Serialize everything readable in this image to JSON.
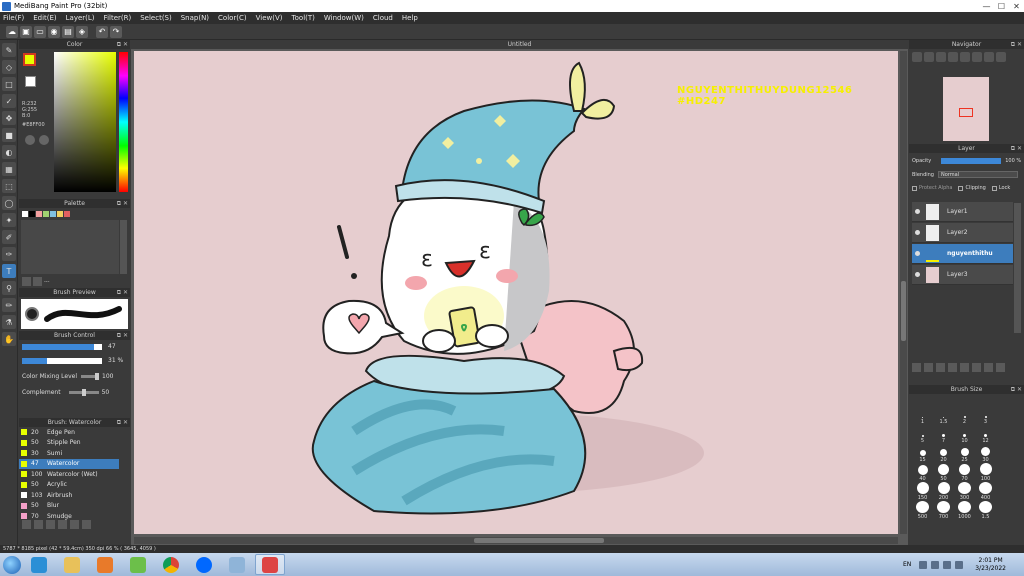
{
  "window": {
    "title": "MediBang Paint Pro (32bit)",
    "minimize": "—",
    "maximize": "☐",
    "close": "✕"
  },
  "menu": [
    "File(F)",
    "Edit(E)",
    "Layer(L)",
    "Filter(R)",
    "Select(S)",
    "Snap(N)",
    "Color(C)",
    "View(V)",
    "Tool(T)",
    "Window(W)",
    "Cloud",
    "Help"
  ],
  "canvas": {
    "tab_title": "Untitled",
    "watermark_line1": "NGUYENTHITHUYDUNG12546",
    "watermark_line2": "#HD247",
    "background": "#e6cdcf"
  },
  "color_panel": {
    "title": "Color",
    "r": "R:232",
    "g": "G:255",
    "b": "B:0",
    "hex": "#E8FF00",
    "foreground": "#e8ff00",
    "background": "#ffffff"
  },
  "palette_panel": {
    "title": "Palette",
    "colors": [
      "#ffffff",
      "#000000",
      "#f4a0a0",
      "#a0d070",
      "#80c0e0",
      "#f0d060",
      "#e06060"
    ],
    "tools_text": "---"
  },
  "brush_preview": {
    "title": "Brush Preview"
  },
  "brush_control": {
    "title": "Brush Control",
    "size_value": "47",
    "opacity_value": "31 %",
    "mixing_label": "Color Mixing Level",
    "mixing_value": "100",
    "complement_label": "Complement",
    "complement_value": "50",
    "size_fraction": 0.9,
    "opacity_fraction": 0.31
  },
  "brush_list": {
    "title": "Brush: Watercolor",
    "items": [
      {
        "size": "20",
        "name": "Edge Pen",
        "color": "#e8ff00"
      },
      {
        "size": "50",
        "name": "Stipple Pen",
        "color": "#e8ff00"
      },
      {
        "size": "30",
        "name": "Sumi",
        "color": "#e8ff00"
      },
      {
        "size": "47",
        "name": "Watercolor",
        "color": "#e8ff00"
      },
      {
        "size": "100",
        "name": "Watercolor (Wet)",
        "color": "#e8ff00"
      },
      {
        "size": "50",
        "name": "Acrylic",
        "color": "#e8ff00"
      },
      {
        "size": "103",
        "name": "Airbrush",
        "color": "#ffffff"
      },
      {
        "size": "50",
        "name": "Blur",
        "color": "#f4a0c8"
      },
      {
        "size": "70",
        "name": "Smudge",
        "color": "#f4a0c8"
      }
    ]
  },
  "navigator": {
    "title": "Navigator"
  },
  "layer_panel": {
    "title": "Layer",
    "opacity_label": "Opacity",
    "opacity_value": "100 %",
    "blending_label": "Blending",
    "blending_value": "Normal",
    "protect_alpha": "Protect Alpha",
    "clipping": "Clipping",
    "lock": "Lock",
    "layers": [
      "Layer1",
      "Layer2",
      "nguyenthithu",
      "Layer3"
    ],
    "active_index": 2
  },
  "brush_size_panel": {
    "title": "Brush Size",
    "sizes": [
      "1",
      "1.5",
      "2",
      "3",
      "5",
      "7",
      "10",
      "12",
      "15",
      "20",
      "25",
      "30",
      "40",
      "50",
      "70",
      "100",
      "150",
      "200",
      "300",
      "400",
      "500",
      "700",
      "1000",
      "1.5"
    ]
  },
  "status": {
    "text": "5787 * 8185 pixel  (42 * 59.4cm)  350 dpi  66 %  ( 3645, 4059 )"
  },
  "taskbar": {
    "lang": "EN",
    "time": "2:01 PM",
    "date": "3/23/2022"
  },
  "colors": {
    "accent": "#3d7dbd",
    "panel": "#3a3a3a",
    "panel_head": "#2f2f2f"
  }
}
